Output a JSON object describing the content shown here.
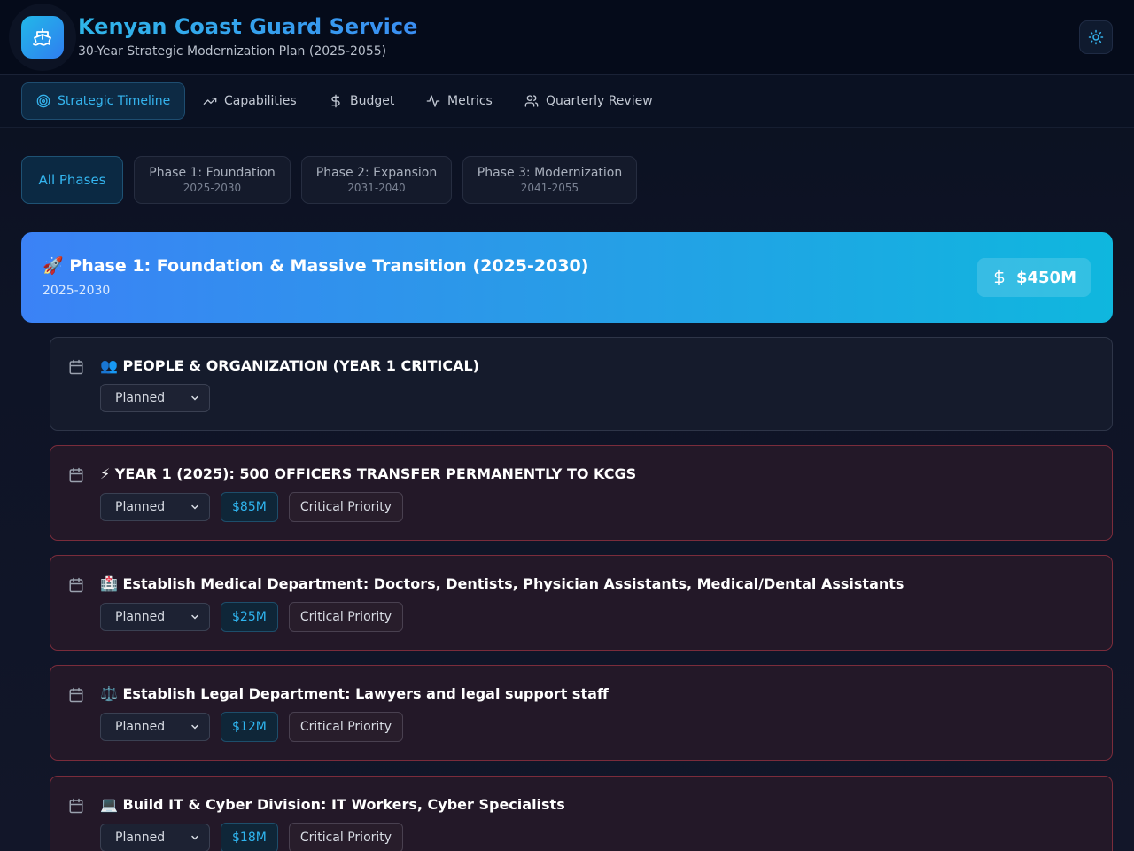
{
  "header": {
    "title": "Kenyan Coast Guard Service",
    "subtitle": "30-Year Strategic Modernization Plan (2025-2055)",
    "logo_icon": "ship-icon",
    "theme_icon": "sun-icon"
  },
  "nav": {
    "tabs": [
      {
        "label": "Strategic Timeline",
        "icon": "target-icon",
        "active": true
      },
      {
        "label": "Capabilities",
        "icon": "trending-up-icon",
        "active": false
      },
      {
        "label": "Budget",
        "icon": "dollar-icon",
        "active": false
      },
      {
        "label": "Metrics",
        "icon": "activity-icon",
        "active": false
      },
      {
        "label": "Quarterly Review",
        "icon": "users-icon",
        "active": false
      }
    ]
  },
  "phase_filter": {
    "all": "All Phases",
    "phases": [
      {
        "label": "Phase 1: Foundation",
        "years": "2025-2030"
      },
      {
        "label": "Phase 2: Expansion",
        "years": "2031-2040"
      },
      {
        "label": "Phase 3: Modernization",
        "years": "2041-2055"
      }
    ]
  },
  "phase_banner": {
    "title": "🚀 Phase 1: Foundation & Massive Transition (2025-2030)",
    "years": "2025-2030",
    "budget": "$450M"
  },
  "items": [
    {
      "title": "👥 PEOPLE & ORGANIZATION (YEAR 1 CRITICAL)",
      "status": "Planned",
      "budget": "",
      "priority": ""
    },
    {
      "title": "⚡ YEAR 1 (2025): 500 OFFICERS TRANSFER PERMANENTLY TO KCGS",
      "status": "Planned",
      "budget": "$85M",
      "priority": "Critical Priority"
    },
    {
      "title": "🏥 Establish Medical Department: Doctors, Dentists, Physician Assistants, Medical/Dental Assistants",
      "status": "Planned",
      "budget": "$25M",
      "priority": "Critical Priority"
    },
    {
      "title": "⚖️ Establish Legal Department: Lawyers and legal support staff",
      "status": "Planned",
      "budget": "$12M",
      "priority": "Critical Priority"
    },
    {
      "title": "💻 Build IT & Cyber Division: IT Workers, Cyber Specialists",
      "status": "Planned",
      "budget": "$18M",
      "priority": "Critical Priority"
    }
  ],
  "colors": {
    "accent": "#35b4ee",
    "critical_border": "#7a2c3b",
    "banner_start": "#3b82f6",
    "banner_end": "#0fb7de"
  }
}
